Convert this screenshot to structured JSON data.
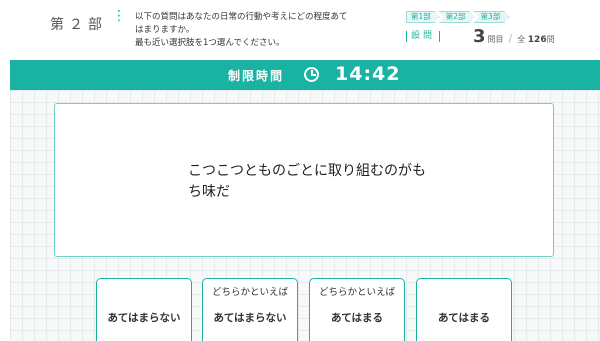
{
  "header": {
    "part_label": "第２部",
    "part_separator": "⋮",
    "instruction_lines": [
      "以下の質問はあなたの日常の行動や考えにどの程度あて",
      "はまりますか。",
      "最も近い選択肢を1つ選んでください。"
    ],
    "steps": [
      "第1部",
      "第2部",
      "第3部"
    ],
    "question_label": "設問",
    "current_question": "3",
    "current_suffix": "問目",
    "total_prefix": "全",
    "total_count": "126",
    "total_suffix": "問",
    "slash": "/"
  },
  "timer": {
    "label": "制限時間",
    "icon": "clock-icon",
    "value": "14:42"
  },
  "question": {
    "text": "こつこつとものごとに取り組むのがもち味だ"
  },
  "answers": [
    {
      "sub": "",
      "main": "あてはまらない"
    },
    {
      "sub": "どちらかといえば",
      "main": "あてはまらない"
    },
    {
      "sub": "どちらかといえば",
      "main": "あてはまる"
    },
    {
      "sub": "",
      "main": "あてはまる"
    }
  ],
  "colors": {
    "accent": "#1ab3a3",
    "accent_light": "#6fd1c5",
    "grid_bg": "#f7f9f9"
  }
}
